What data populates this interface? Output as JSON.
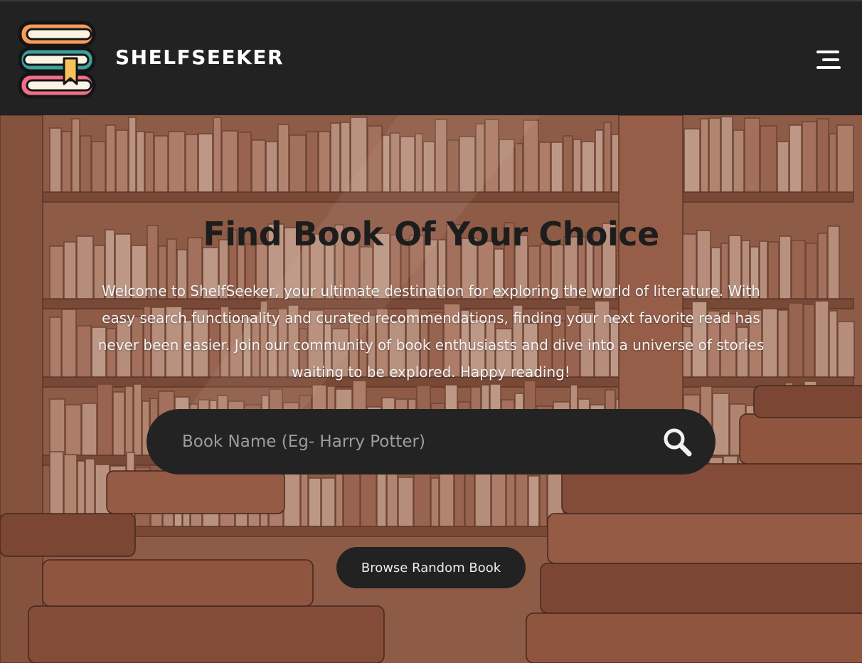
{
  "header": {
    "brand": "SHELFSEEKER",
    "logo_icon": "stacked-books-logo",
    "menu_icon": "hamburger-menu-icon"
  },
  "hero": {
    "title": "Find Book Of Your Choice",
    "description": "Welcome to ShelfSeeker, your ultimate destination for exploring the world of literature. With easy search functionality and curated recommendations, finding your next favorite read has never been easier. Join our community of book enthusiasts and dive into a universe of stories waiting to be explored. Happy reading!",
    "search": {
      "placeholder": "Book Name (Eg- Harry Potter)",
      "value": "",
      "icon": "search-icon"
    },
    "random_button": "Browse Random Book"
  },
  "colors": {
    "header_bg": "#222222",
    "hero_tint": "#8a5a44",
    "search_bg": "#232323",
    "title_text": "#1d1d1d"
  }
}
